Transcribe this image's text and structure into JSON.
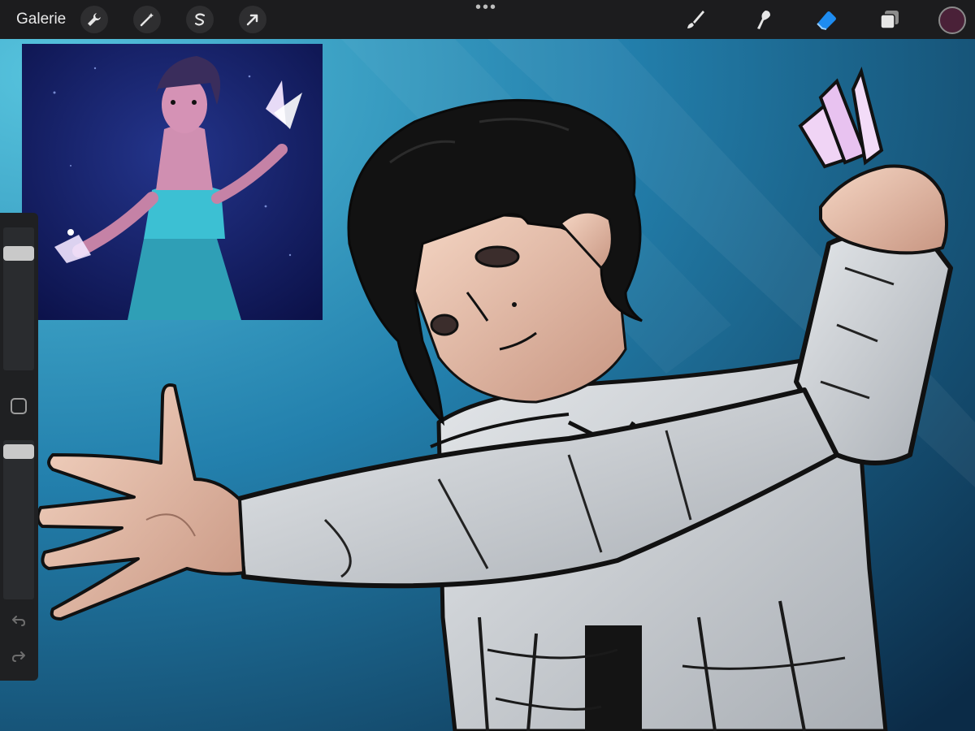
{
  "toolbar": {
    "gallery_label": "Galerie",
    "left_tools": [
      {
        "icon": "wrench-icon",
        "name": "actions-button"
      },
      {
        "icon": "magic-wand-icon",
        "name": "adjustments-button"
      },
      {
        "icon": "selection-s-icon",
        "name": "selection-button"
      },
      {
        "icon": "arrow-cursor-icon",
        "name": "transform-button"
      }
    ],
    "more_label": "•••",
    "right_tools": [
      "brush-icon",
      "smudge-icon",
      "eraser-icon",
      "layers-icon"
    ],
    "active_tool": "eraser-icon",
    "current_color": "#4a2138"
  },
  "sidebar": {
    "brush_size": 0.85,
    "opacity": 0.85,
    "modify_icon": "square-icon",
    "undo_icon": "undo-arrow-icon",
    "redo_icon": "redo-arrow-icon"
  },
  "colors": {
    "canvas_light": "#4fb4d1",
    "canvas_dark": "#0f3553",
    "accent_blue": "#1e8cf0"
  }
}
